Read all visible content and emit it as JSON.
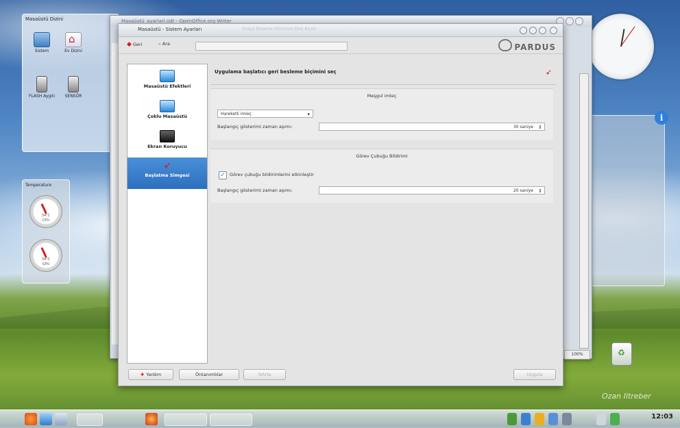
{
  "desktop": {
    "folderview": {
      "title": "Masaüstü Dizini",
      "icons": [
        {
          "label": "Sistem"
        },
        {
          "label": "Ev Dizini"
        },
        {
          "label": "FLASH Aygıtı"
        },
        {
          "label": "SENSÖR"
        }
      ]
    },
    "temperature": {
      "title": "Temperature",
      "gauges": [
        {
          "value": "34°C",
          "label": "CPU"
        },
        {
          "value": "34°C",
          "label": "GPU"
        }
      ]
    },
    "watermark": "Ozan Iltreber",
    "colors": {
      "sky": "#4f86c4",
      "grass": "#6c9a34"
    }
  },
  "writer": {
    "title": "Masaüstü_ayarlari.odt - OpenOffice.org Writer",
    "zoom": "100%"
  },
  "dialog": {
    "title": "Masaüstü - Sistem Ayarları",
    "title_ghost": "Dosya  Düzenle  Görünüm  Ekle  Biçim",
    "toolbar": {
      "back_label": "Geri",
      "search_label": "Ara",
      "search_value": "",
      "logo_text": "PARDUS"
    },
    "sidebar": [
      {
        "label": "Masaüstü Efektleri",
        "icon": "monitor-icon",
        "selected": false
      },
      {
        "label": "Çoklu Masaüstü",
        "icon": "desktops-icon",
        "selected": false
      },
      {
        "label": "Ekran Koruyucu",
        "icon": "screen-icon",
        "selected": false
      },
      {
        "label": "Başlatma Simgesi",
        "icon": "rocket-icon",
        "selected": true
      }
    ],
    "main": {
      "heading": "Uygulama başlatıcı geri besleme biçimini seç",
      "busy_cursor": {
        "title": "Meşgul imleç",
        "combo_value": "Hareketli imleç",
        "timeout_label": "Başlangıç gösterimi zaman aşımı:",
        "timeout_value": "30 saniye"
      },
      "taskbar_notification": {
        "title": "Görev Çubuğu Bildirimi",
        "checkbox_label": "Görev çubuğu bildirimlerini etkinleştir",
        "checkbox_checked": true,
        "timeout_label": "Başlangıç gösterimi zaman aşımı:",
        "timeout_value": "20 saniye"
      }
    },
    "buttons": {
      "help": "Yardım",
      "defaults": "Öntanımlılar",
      "reset": "Sıfırla",
      "apply": "Uygula"
    }
  },
  "taskbar": {
    "clock": "12:03"
  }
}
